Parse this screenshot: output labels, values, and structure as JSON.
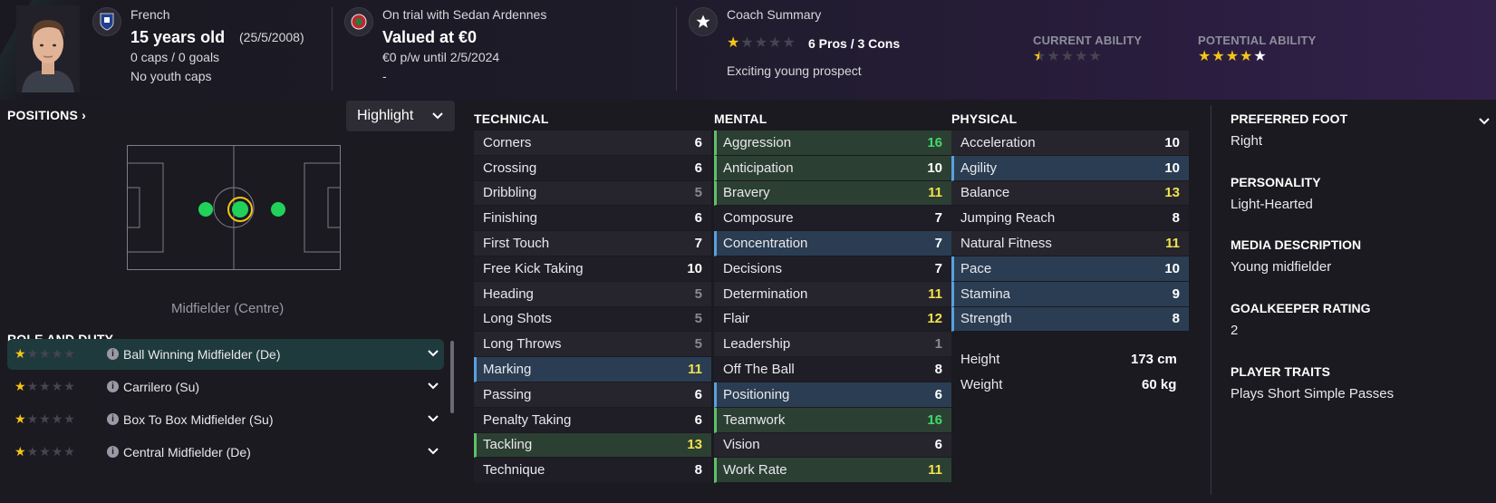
{
  "header": {
    "nationality": "French",
    "age": "15 years old",
    "dob": "(25/5/2008)",
    "caps": "0 caps / 0 goals",
    "youth": "No youth caps",
    "club_status": "On trial with Sedan Ardennes",
    "value": "Valued at €0",
    "wage": "€0 p/w until 2/5/2024",
    "dash": "-",
    "coach_title": "Coach Summary",
    "pros_cons": "6 Pros / 3 Cons",
    "coach_text": "Exciting young prospect",
    "coach_stars": 1,
    "ca_label": "CURRENT ABILITY",
    "ca_stars": 0.5,
    "pa_label": "POTENTIAL ABILITY",
    "pa_stars": 4.5
  },
  "positions": {
    "title": "POSITIONS",
    "highlight_label": "Highlight",
    "position_name": "Midfielder (Centre)"
  },
  "role": {
    "title": "ROLE AND DUTY",
    "items": [
      {
        "stars": 1,
        "name": "Ball Winning Midfielder (De)"
      },
      {
        "stars": 1,
        "name": "Carrilero (Su)"
      },
      {
        "stars": 1,
        "name": "Box To Box Midfielder (Su)"
      },
      {
        "stars": 1,
        "name": "Central Midfielder (De)"
      }
    ]
  },
  "technical": {
    "title": "TECHNICAL",
    "rows": [
      {
        "name": "Corners",
        "value": "6",
        "color": "white",
        "hl": ""
      },
      {
        "name": "Crossing",
        "value": "6",
        "color": "white",
        "hl": ""
      },
      {
        "name": "Dribbling",
        "value": "5",
        "color": "grey",
        "hl": ""
      },
      {
        "name": "Finishing",
        "value": "6",
        "color": "white",
        "hl": ""
      },
      {
        "name": "First Touch",
        "value": "7",
        "color": "white",
        "hl": ""
      },
      {
        "name": "Free Kick Taking",
        "value": "10",
        "color": "white",
        "hl": ""
      },
      {
        "name": "Heading",
        "value": "5",
        "color": "grey",
        "hl": ""
      },
      {
        "name": "Long Shots",
        "value": "5",
        "color": "grey",
        "hl": ""
      },
      {
        "name": "Long Throws",
        "value": "5",
        "color": "grey",
        "hl": ""
      },
      {
        "name": "Marking",
        "value": "11",
        "color": "yellow",
        "hl": "blue"
      },
      {
        "name": "Passing",
        "value": "6",
        "color": "white",
        "hl": ""
      },
      {
        "name": "Penalty Taking",
        "value": "6",
        "color": "white",
        "hl": ""
      },
      {
        "name": "Tackling",
        "value": "13",
        "color": "yellow",
        "hl": "green"
      },
      {
        "name": "Technique",
        "value": "8",
        "color": "white",
        "hl": ""
      }
    ]
  },
  "mental": {
    "title": "MENTAL",
    "rows": [
      {
        "name": "Aggression",
        "value": "16",
        "color": "green",
        "hl": "green"
      },
      {
        "name": "Anticipation",
        "value": "10",
        "color": "white",
        "hl": "green"
      },
      {
        "name": "Bravery",
        "value": "11",
        "color": "yellow",
        "hl": "green"
      },
      {
        "name": "Composure",
        "value": "7",
        "color": "white",
        "hl": ""
      },
      {
        "name": "Concentration",
        "value": "7",
        "color": "white",
        "hl": "blue"
      },
      {
        "name": "Decisions",
        "value": "7",
        "color": "white",
        "hl": ""
      },
      {
        "name": "Determination",
        "value": "11",
        "color": "yellow",
        "hl": ""
      },
      {
        "name": "Flair",
        "value": "12",
        "color": "yellow",
        "hl": ""
      },
      {
        "name": "Leadership",
        "value": "1",
        "color": "grey",
        "hl": ""
      },
      {
        "name": "Off The Ball",
        "value": "8",
        "color": "white",
        "hl": ""
      },
      {
        "name": "Positioning",
        "value": "6",
        "color": "white",
        "hl": "blue"
      },
      {
        "name": "Teamwork",
        "value": "16",
        "color": "green",
        "hl": "green"
      },
      {
        "name": "Vision",
        "value": "6",
        "color": "white",
        "hl": ""
      },
      {
        "name": "Work Rate",
        "value": "11",
        "color": "yellow",
        "hl": "green"
      }
    ]
  },
  "physical": {
    "title": "PHYSICAL",
    "rows": [
      {
        "name": "Acceleration",
        "value": "10",
        "color": "white",
        "hl": ""
      },
      {
        "name": "Agility",
        "value": "10",
        "color": "white",
        "hl": "blue"
      },
      {
        "name": "Balance",
        "value": "13",
        "color": "yellow",
        "hl": ""
      },
      {
        "name": "Jumping Reach",
        "value": "8",
        "color": "white",
        "hl": ""
      },
      {
        "name": "Natural Fitness",
        "value": "11",
        "color": "yellow",
        "hl": ""
      },
      {
        "name": "Pace",
        "value": "10",
        "color": "white",
        "hl": "blue"
      },
      {
        "name": "Stamina",
        "value": "9",
        "color": "white",
        "hl": "blue"
      },
      {
        "name": "Strength",
        "value": "8",
        "color": "white",
        "hl": "blue"
      }
    ],
    "height_label": "Height",
    "height_value": "173 cm",
    "weight_label": "Weight",
    "weight_value": "60 kg"
  },
  "info": {
    "foot_label": "PREFERRED FOOT",
    "foot_value": "Right",
    "personality_label": "PERSONALITY",
    "personality_value": "Light-Hearted",
    "media_label": "MEDIA DESCRIPTION",
    "media_value": "Young midfielder",
    "gk_label": "GOALKEEPER RATING",
    "gk_value": "2",
    "traits_label": "PLAYER TRAITS",
    "traits_value": "Plays Short Simple Passes"
  },
  "colors": {
    "accent_green": "#42d96a",
    "accent_yellow": "#f2e24b",
    "star": "#f5c518",
    "hl_blue": "#2b3d52",
    "hl_green": "#2c3f33"
  }
}
